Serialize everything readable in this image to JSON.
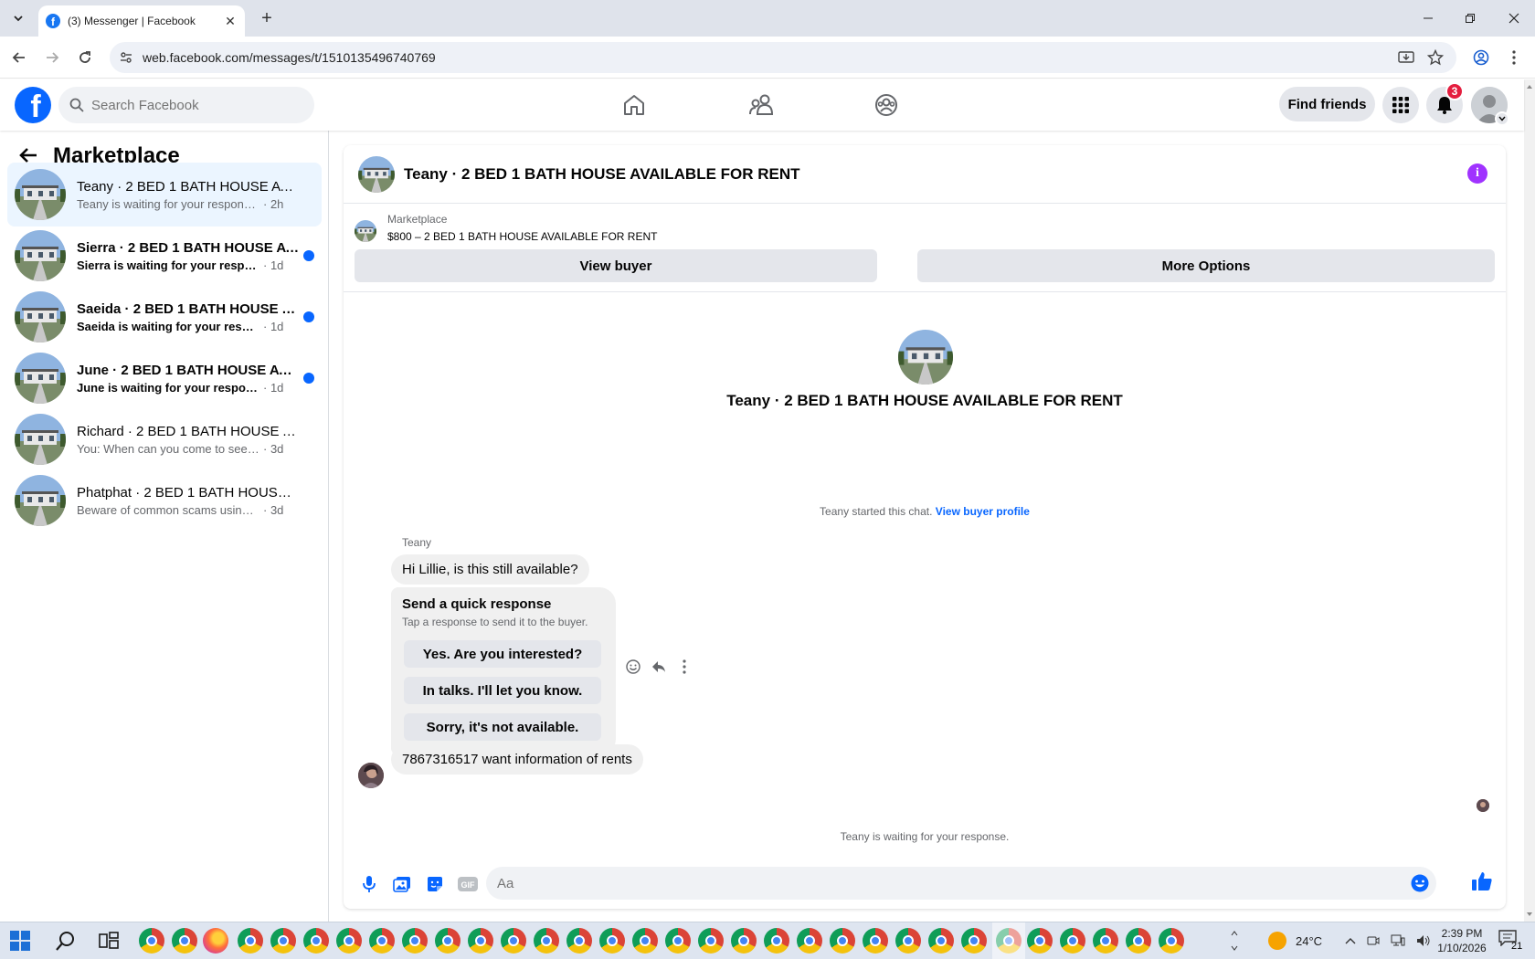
{
  "browser": {
    "tab_title": "(3) Messenger | Facebook",
    "url": "web.facebook.com/messages/t/1510135496740769"
  },
  "fb": {
    "search_placeholder": "Search Facebook",
    "find_friends": "Find friends",
    "notification_count": "3"
  },
  "sidebar": {
    "title": "Marketplace",
    "conversations": [
      {
        "name": "Teany · 2 BED 1 BATH HOUSE AVAI...",
        "preview": "Teany is waiting for your response.",
        "time": "· 2h",
        "active": true,
        "unread": false
      },
      {
        "name": "Sierra · 2 BED 1 BATH HOUSE AV...",
        "preview": "Sierra is waiting for your response.",
        "time": "· 1d",
        "active": false,
        "unread": true
      },
      {
        "name": "Saeida · 2 BED 1 BATH HOUSE AV...",
        "preview": "Saeida is waiting for your response.",
        "time": "· 1d",
        "active": false,
        "unread": true
      },
      {
        "name": "June · 2 BED 1 BATH HOUSE AVA...",
        "preview": "June is waiting for your response.",
        "time": "· 1d",
        "active": false,
        "unread": true
      },
      {
        "name": "Richard · 2 BED 1 BATH HOUSE AV...",
        "preview": "You: When can you come to see the h...",
        "time": "· 3d",
        "active": false,
        "unread": false
      },
      {
        "name": "Phatphat · 2 BED 1 BATH HOUSE A...",
        "preview": "Beware of common scams using pay...",
        "time": "· 3d",
        "active": false,
        "unread": false
      }
    ]
  },
  "chat": {
    "title": "Teany · 2 BED 1 BATH HOUSE AVAILABLE FOR RENT",
    "listing_label": "Marketplace",
    "listing_price": "$800 – 2 BED 1 BATH HOUSE AVAILABLE FOR RENT",
    "view_buyer": "View buyer",
    "more_options": "More Options",
    "intro_title": "Teany · 2 BED 1 BATH HOUSE AVAILABLE FOR RENT",
    "started_text": "Teany started this chat.",
    "view_buyer_profile": "View buyer profile",
    "sender": "Teany",
    "message_1": "Hi Lillie, is this still available?",
    "quick_title": "Send a quick response",
    "quick_sub": "Tap a response to send it to the buyer.",
    "quick_replies": [
      "Yes. Are you interested?",
      "In talks. I'll let you know.",
      "Sorry, it's not available."
    ],
    "message_2": "7867316517 want information of rents",
    "waiting": "Teany is waiting for your response.",
    "composer_placeholder": "Aa"
  },
  "taskbar": {
    "temperature": "24°C",
    "time": "2:39 PM",
    "date": "1/10/2026",
    "notifications": "21"
  }
}
